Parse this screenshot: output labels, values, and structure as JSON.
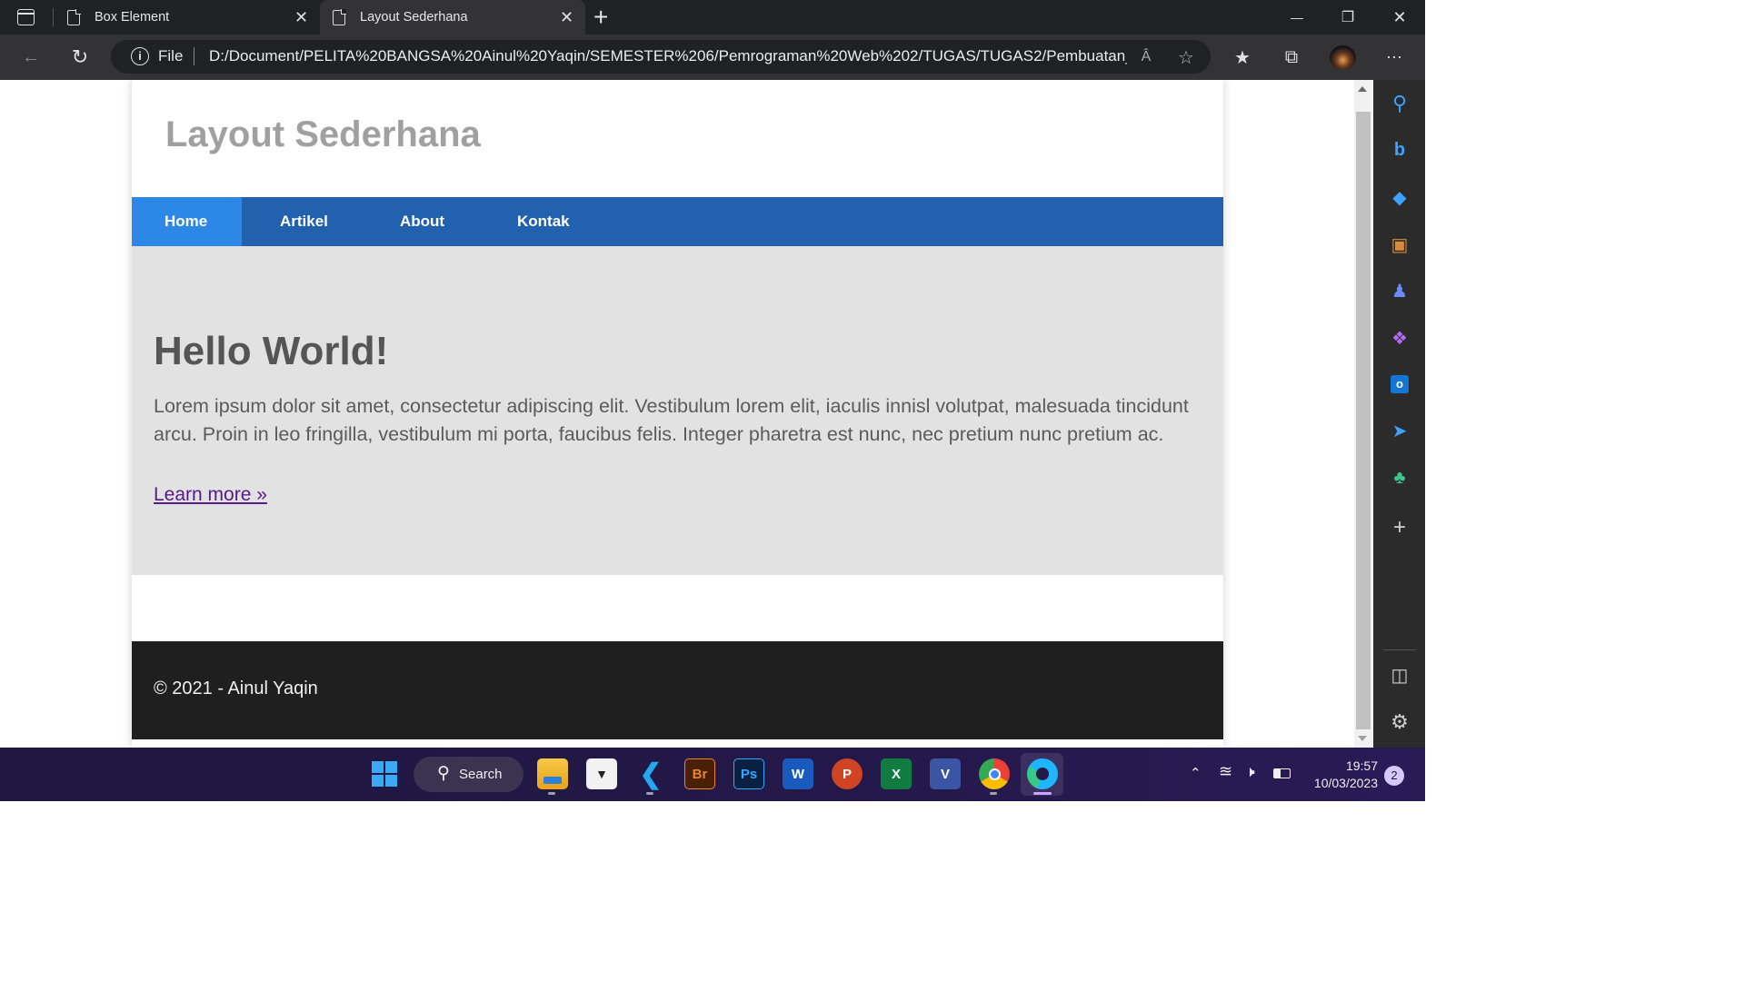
{
  "browser": {
    "tabs": [
      {
        "title": "Box Element",
        "close": "✕"
      },
      {
        "title": "Layout Sederhana",
        "close": "✕"
      }
    ],
    "new_tab": "+",
    "window_controls": {
      "minimize": "—",
      "restore": "❐",
      "close": "✕"
    },
    "address": {
      "scheme_label": "File",
      "info": "i",
      "url": "D:/Document/PELITA%20BANGSA%20Ainul%20Yaqin/SEMESTER%206/Pemrograman%20Web%202/TUGAS/TUGAS2/Pembuatan_La..."
    },
    "toolbar_icons": [
      "read-aloud-icon",
      "add-favorite-icon",
      "favorites-icon",
      "collections-icon",
      "profile-icon",
      "more-icon"
    ]
  },
  "site": {
    "title": "Layout Sederhana",
    "menu": [
      {
        "label": "Home",
        "active": true
      },
      {
        "label": "Artikel"
      },
      {
        "label": "About"
      },
      {
        "label": "Kontak"
      }
    ],
    "hero": {
      "heading": "Hello World!",
      "text": "Lorem ipsum dolor sit amet, consectetur adipiscing elit. Vestibulum lorem elit, iaculis innisl volutpat, malesuada tincidunt arcu. Proin in leo fringilla, vestibulum mi porta, faucibus felis. Integer pharetra est nunc, nec pretium nunc pretium ac.",
      "link": "Learn more »"
    },
    "footer": "© 2021 - Ainul Yaqin"
  },
  "colors": {
    "menu_bg": "#2161ad",
    "menu_active": "#2c87e6",
    "hero_bg": "#e2e2e2",
    "footer_bg": "#1f1f1f"
  },
  "sidebar_icons": [
    "search-icon",
    "bing-icon",
    "shopping-tag-icon",
    "tools-icon",
    "games-icon",
    "copilot-icon",
    "outlook-icon",
    "telegram-icon",
    "tree-icon",
    "add-icon",
    "split-screen-icon",
    "settings-icon"
  ],
  "taskbar": {
    "search_label": "Search",
    "apps": [
      "start-icon",
      "file-explorer-icon",
      "store-icon",
      "vscode-icon",
      "bridge-icon",
      "photoshop-icon",
      "word-icon",
      "powerpoint-icon",
      "excel-icon",
      "visio-icon",
      "chrome-icon",
      "edge-icon"
    ],
    "app_labels": {
      "bridge": "Br",
      "photoshop": "Ps",
      "word": "W",
      "powerpoint": "P",
      "excel": "X",
      "visio": "V"
    },
    "clock_time": "19:57",
    "clock_date": "10/03/2023",
    "notifications": "2"
  }
}
